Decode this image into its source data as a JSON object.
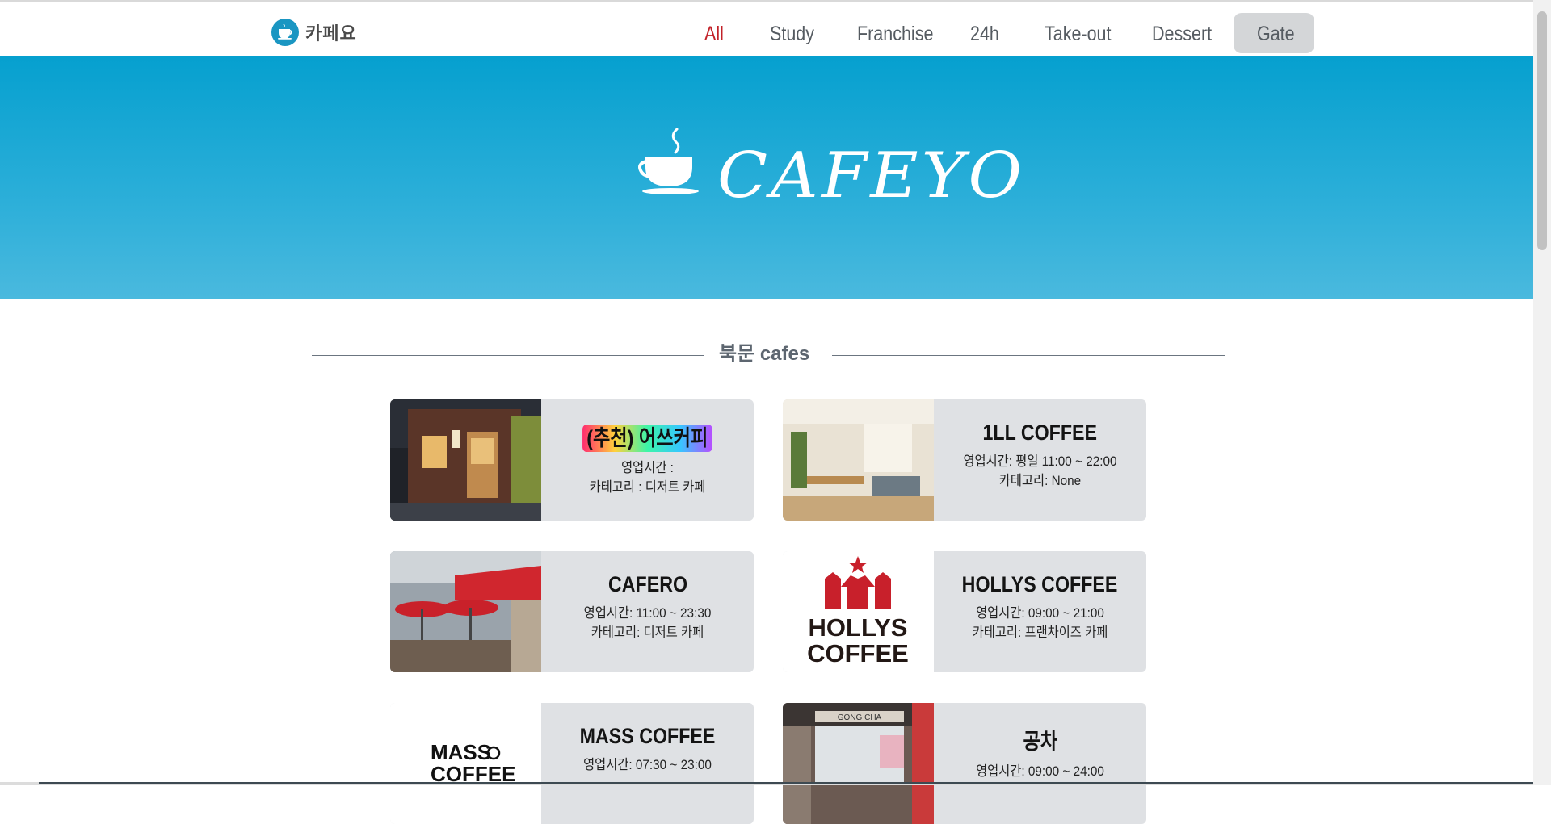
{
  "nav": {
    "logo_text": "카페요",
    "items": [
      {
        "label": "All"
      },
      {
        "label": "Study"
      },
      {
        "label": "Franchise"
      },
      {
        "label": "24h"
      },
      {
        "label": "Take-out"
      },
      {
        "label": "Dessert"
      }
    ],
    "gate_label": "Gate",
    "active_color": "#c22128",
    "text_color": "#555b61"
  },
  "hero": {
    "title": "CAFEYO",
    "background_color": "#1ba6d4"
  },
  "section": {
    "title": "북문 cafes"
  },
  "cafes": [
    {
      "name": "(추천) 어쓰커피",
      "hours": "영업시간 :",
      "category": "카테고리 : 디저트 카페",
      "thumb": "storefront-night-photo",
      "highlight": true
    },
    {
      "name": "1LL COFFEE",
      "hours": "영업시간: 평일 11:00 ~ 22:00",
      "category": "카테고리: None",
      "thumb": "interior-photo"
    },
    {
      "name": "CAFERO",
      "hours": "영업시간: 11:00 ~ 23:30",
      "category": "카테고리: 디저트 카페",
      "thumb": "red-awning-terrace-photo"
    },
    {
      "name": "HOLLYS COFFEE",
      "hours": "영업시간: 09:00 ~ 21:00",
      "category": "카테고리: 프랜차이즈 카페",
      "thumb": "hollys-logo",
      "logo_text_1": "HOLLYS",
      "logo_text_2": "COFFEE"
    },
    {
      "name": "MASS COFFEE",
      "hours": "영업시간: 07:30 ~ 23:00",
      "category": "",
      "thumb": "mass-coffee-logo",
      "logo_text_1": "MASS",
      "logo_text_2": "COFFEE"
    },
    {
      "name": "공차",
      "hours": "영업시간: 09:00 ~ 24:00",
      "category": "",
      "thumb": "gongcha-storefront-photo",
      "sign_text": "GONG CHA"
    }
  ]
}
